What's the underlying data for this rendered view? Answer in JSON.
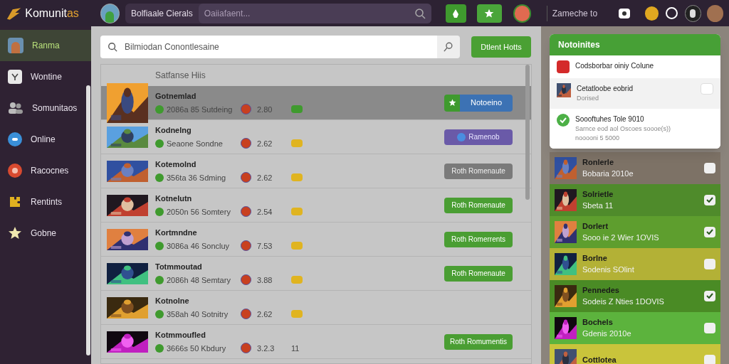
{
  "topbar": {
    "logo": {
      "main": "Komunit",
      "accent": "as"
    },
    "channel_label": "Bolfiaale Cierals",
    "search": {
      "placeholder": "Oaiiafaent..."
    },
    "status_text": "Zameche to"
  },
  "sidebar": {
    "items": [
      {
        "label": "Ranma",
        "selected": true
      },
      {
        "label": "Wontine",
        "selected": false
      },
      {
        "label": "Somunitaos",
        "selected": false
      },
      {
        "label": "Online",
        "selected": false
      },
      {
        "label": "Racocnes",
        "selected": false
      },
      {
        "label": "Rentints",
        "selected": false
      },
      {
        "label": "Gobne",
        "selected": false
      }
    ]
  },
  "main": {
    "search": {
      "placeholder": "Bilmiodan Conontlesaine"
    },
    "action_button": "Dtlent Hotts",
    "list": {
      "header": "Satfanse Hiis",
      "rows": [
        {
          "title": "Gotnemlad",
          "meta": "2086a 85 Sutdeing",
          "rating": "2.80",
          "color": "#3f9a2e",
          "selected": true,
          "button": {
            "kind": "split",
            "label": "Notoeino"
          }
        },
        {
          "title": "Kodnelng",
          "meta": "Seaone Sondne",
          "rating": "2.62",
          "color": "#e0b420",
          "selected": false,
          "button": {
            "kind": "purple",
            "label": "Ramenob"
          }
        },
        {
          "title": "Kotemolnd",
          "meta": "356ta 36 Sdming",
          "rating": "2.62",
          "color": "#e0b420",
          "selected": false,
          "button": {
            "kind": "gray",
            "label": "Roth Romenaute"
          }
        },
        {
          "title": "Kotnelutn",
          "meta": "2050n 56 Somtery",
          "rating": "2.54",
          "color": "#e0b420",
          "selected": false,
          "button": {
            "kind": "green",
            "label": "Roth Romenaute"
          }
        },
        {
          "title": "Kortmndne",
          "meta": "3086a 46 Soncluy",
          "rating": "7.53",
          "color": "#e0b420",
          "selected": false,
          "button": {
            "kind": "green",
            "label": "Roth Romerrents"
          }
        },
        {
          "title": "Totmmoutad",
          "meta": "2086h 48 Semtary",
          "rating": "3.88",
          "color": "#e0b420",
          "selected": false,
          "button": {
            "kind": "green",
            "label": "Roth Romenaute"
          }
        },
        {
          "title": "Kotnolne",
          "meta": "358ah 40 Sotnitry",
          "rating": "2.62",
          "color": "#e0b420",
          "selected": false
        },
        {
          "title": "Kotmmoufled",
          "meta": "3666s 50 Kbdury",
          "rating": "3.2.3",
          "extra": "11",
          "selected": false,
          "button": {
            "kind": "green",
            "label": "Roth Romumentis"
          }
        }
      ]
    }
  },
  "notifications": {
    "title": "Notoinites",
    "items": [
      {
        "kind": "alert",
        "title": "Codsborbar oiniy Colune"
      },
      {
        "kind": "person",
        "title": "Cetatloobe eobrid",
        "subtitle": "Dorised"
      },
      {
        "kind": "success",
        "title": "Soooftuhes Tole 9010",
        "subtitle": "Sarnce eod aol Oscoes soooe(s)) nooooni 5 5000"
      }
    ]
  },
  "friends": [
    {
      "name": "Ronlerle",
      "status": "Bobaria 2010e",
      "color": "#7d7266",
      "checked": false
    },
    {
      "name": "Solrietle",
      "status": "Sbeta 11",
      "color": "#4f8b2b",
      "checked": true
    },
    {
      "name": "Dorlert",
      "status": "Sooo ie 2 Wier 1OVIS",
      "color": "#5e9e2e",
      "checked": true
    },
    {
      "name": "Borlne",
      "status": "Sodenis SOlint",
      "color": "#b3b136",
      "checked": false
    },
    {
      "name": "Pennedes",
      "status": "Sodeis Z Nties 1DOVIS",
      "color": "#4a8b25",
      "checked": true
    },
    {
      "name": "Bochels",
      "status": "Gdenis 2010e",
      "color": "#5cb33d",
      "checked": false
    },
    {
      "name": "Cottlotea",
      "color": "#c9c43b",
      "checked": false
    }
  ]
}
